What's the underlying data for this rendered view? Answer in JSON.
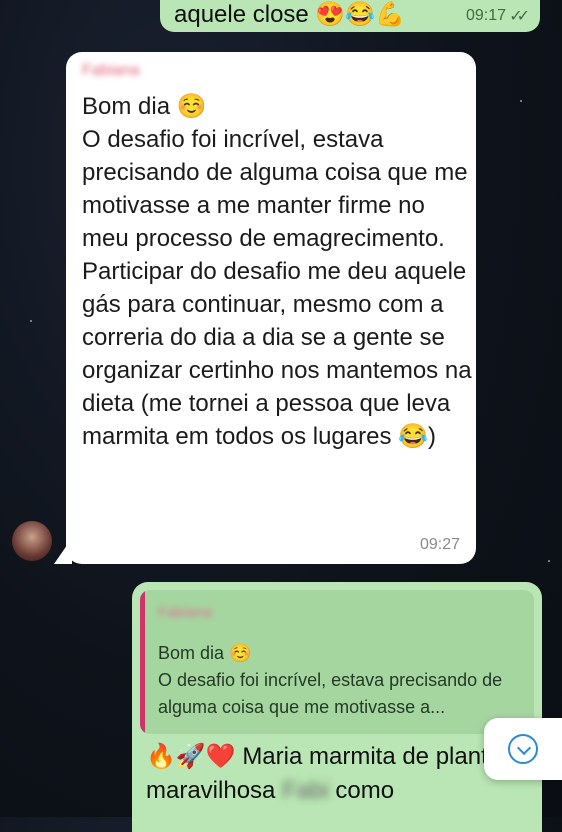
{
  "messages": [
    {
      "direction": "outgoing",
      "text": "aquele close 😍😂💪",
      "emojis": "",
      "time": "09:17",
      "status": "read"
    },
    {
      "direction": "incoming",
      "sender": "Fabiana",
      "text": "Bom dia ☺️\nO desafio foi incrível, estava precisando de alguma coisa que me motivasse a me manter firme no meu processo de emagrecimento.\nParticipar do desafio me deu aquele gás para continuar, mesmo com a correria do dia a dia se a gente se organizar certinho nos mantemos na dieta (me tornei a pessoa que leva marmita em todos os lugares 😂)",
      "time": "09:27"
    },
    {
      "direction": "outgoing",
      "quote": {
        "sender": "Fabiana",
        "text": "Bom dia ☺️\nO desafio foi incrível, estava precisando de alguma coisa que me motivasse a..."
      },
      "text_start": "🔥🚀❤️ Maria marmita de plantão, maravilhosa ",
      "text_blur": "Fabi",
      "text_end": " como"
    }
  ],
  "scroll_button": {
    "icon": "chevron-down-icon"
  },
  "colors": {
    "outgoing_bubble": "#b9e6b4",
    "incoming_bubble": "#ffffff",
    "quote_bar": "#d0336a",
    "background": "#0e131b"
  }
}
